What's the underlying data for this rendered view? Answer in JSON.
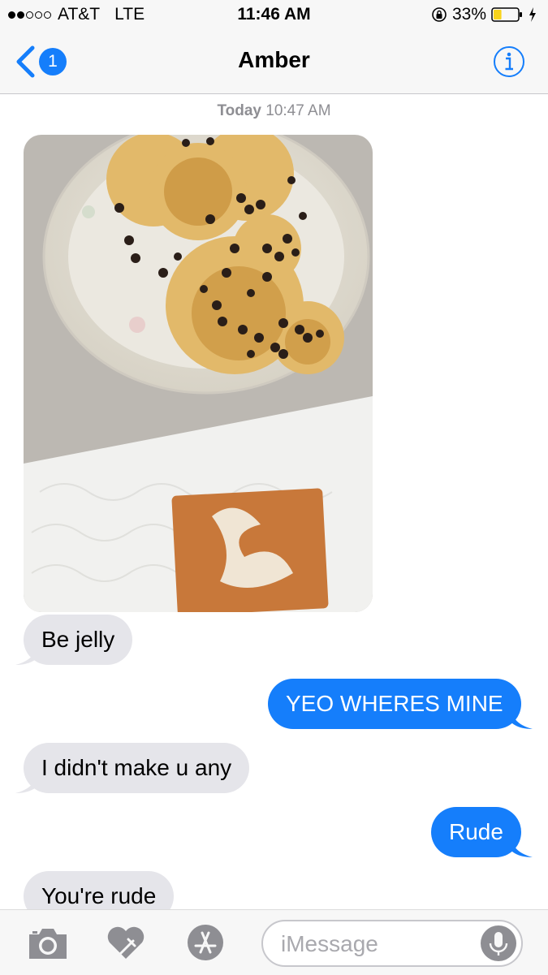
{
  "status_bar": {
    "carrier": "AT&T",
    "network": "LTE",
    "time": "11:46 AM",
    "battery_percent": "33%",
    "battery_level": 0.33,
    "icons": [
      "signal-dots-icon",
      "orientation-lock-icon",
      "battery-icon",
      "charging-bolt-icon"
    ]
  },
  "nav": {
    "back_badge": "1",
    "title": "Amber",
    "icons": [
      "back-chevron-icon",
      "info-icon"
    ]
  },
  "timestamp": {
    "day": "Today",
    "time": "10:47 AM"
  },
  "photo": {
    "description_icon": "photo-attachment"
  },
  "messages": [
    {
      "from": "them",
      "text": "Be jelly"
    },
    {
      "from": "me",
      "text": "YEO WHERES MINE"
    },
    {
      "from": "them",
      "text": "I didn't make u any"
    },
    {
      "from": "me",
      "text": "Rude"
    },
    {
      "from": "them",
      "text": "You're rude"
    }
  ],
  "input_bar": {
    "placeholder": "iMessage",
    "icons": [
      "camera-icon",
      "digital-touch-icon",
      "app-store-icon",
      "microphone-icon"
    ]
  },
  "colors": {
    "ios_blue": "#157efb",
    "incoming_bubble": "#e5e5ea",
    "battery_yellow": "#f8d41c"
  }
}
